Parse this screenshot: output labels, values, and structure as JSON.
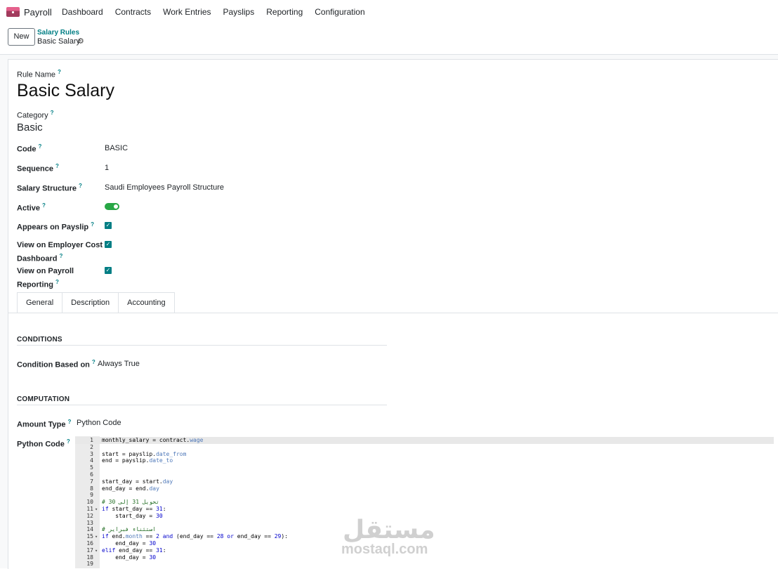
{
  "navbar": {
    "app_name": "Payroll",
    "menu": [
      "Dashboard",
      "Contracts",
      "Work Entries",
      "Payslips",
      "Reporting",
      "Configuration"
    ]
  },
  "control": {
    "new_label": "New",
    "breadcrumb_parent": "Salary Rules",
    "breadcrumb_current": "Basic Salary"
  },
  "form": {
    "rule_name_label": "Rule Name",
    "rule_name": "Basic Salary",
    "category_label": "Category",
    "category": "Basic",
    "code_label": "Code",
    "code": "BASIC",
    "sequence_label": "Sequence",
    "sequence": "1",
    "structure_label": "Salary Structure",
    "structure": "Saudi Employees Payroll Structure",
    "active_label": "Active",
    "active": true,
    "appears_label": "Appears on Payslip",
    "appears": true,
    "employer_cost_label_1": "View on Employer Cost",
    "employer_cost_label_2": "Dashboard",
    "employer_cost": true,
    "payroll_reporting_label_1": "View on Payroll",
    "payroll_reporting_label_2": "Reporting",
    "payroll_reporting": true,
    "question_mark": "?"
  },
  "tabs": [
    "General",
    "Description",
    "Accounting"
  ],
  "general": {
    "conditions_title": "CONDITIONS",
    "condition_label": "Condition Based on",
    "condition_value": "Always True",
    "computation_title": "COMPUTATION",
    "amount_type_label": "Amount Type",
    "amount_type_value": "Python Code",
    "python_code_label": "Python Code"
  },
  "code_lines": [
    {
      "n": "1",
      "text": "monthly_salary = contract.wage"
    },
    {
      "n": "2",
      "text": ""
    },
    {
      "n": "3",
      "text": "start = payslip.date_from"
    },
    {
      "n": "4",
      "text": "end = payslip.date_to"
    },
    {
      "n": "5",
      "text": ""
    },
    {
      "n": "6",
      "text": ""
    },
    {
      "n": "7",
      "text": "start_day = start.day"
    },
    {
      "n": "8",
      "text": "end_day = end.day"
    },
    {
      "n": "9",
      "text": ""
    },
    {
      "n": "10",
      "text": "# تحويل 31 إلى 30"
    },
    {
      "n": "11",
      "text": "if start_day == 31:"
    },
    {
      "n": "12",
      "text": "    start_day = 30"
    },
    {
      "n": "13",
      "text": ""
    },
    {
      "n": "14",
      "text": "# استثناء فبراير"
    },
    {
      "n": "15",
      "text": "if end.month == 2 and (end_day == 28 or end_day == 29):"
    },
    {
      "n": "16",
      "text": "    end_day = 30"
    },
    {
      "n": "17",
      "text": "elif end_day == 31:"
    },
    {
      "n": "18",
      "text": "    end_day = 30"
    },
    {
      "n": "19",
      "text": ""
    }
  ],
  "watermark": {
    "arabic": "مستقل",
    "latin": "mostaql.com"
  }
}
